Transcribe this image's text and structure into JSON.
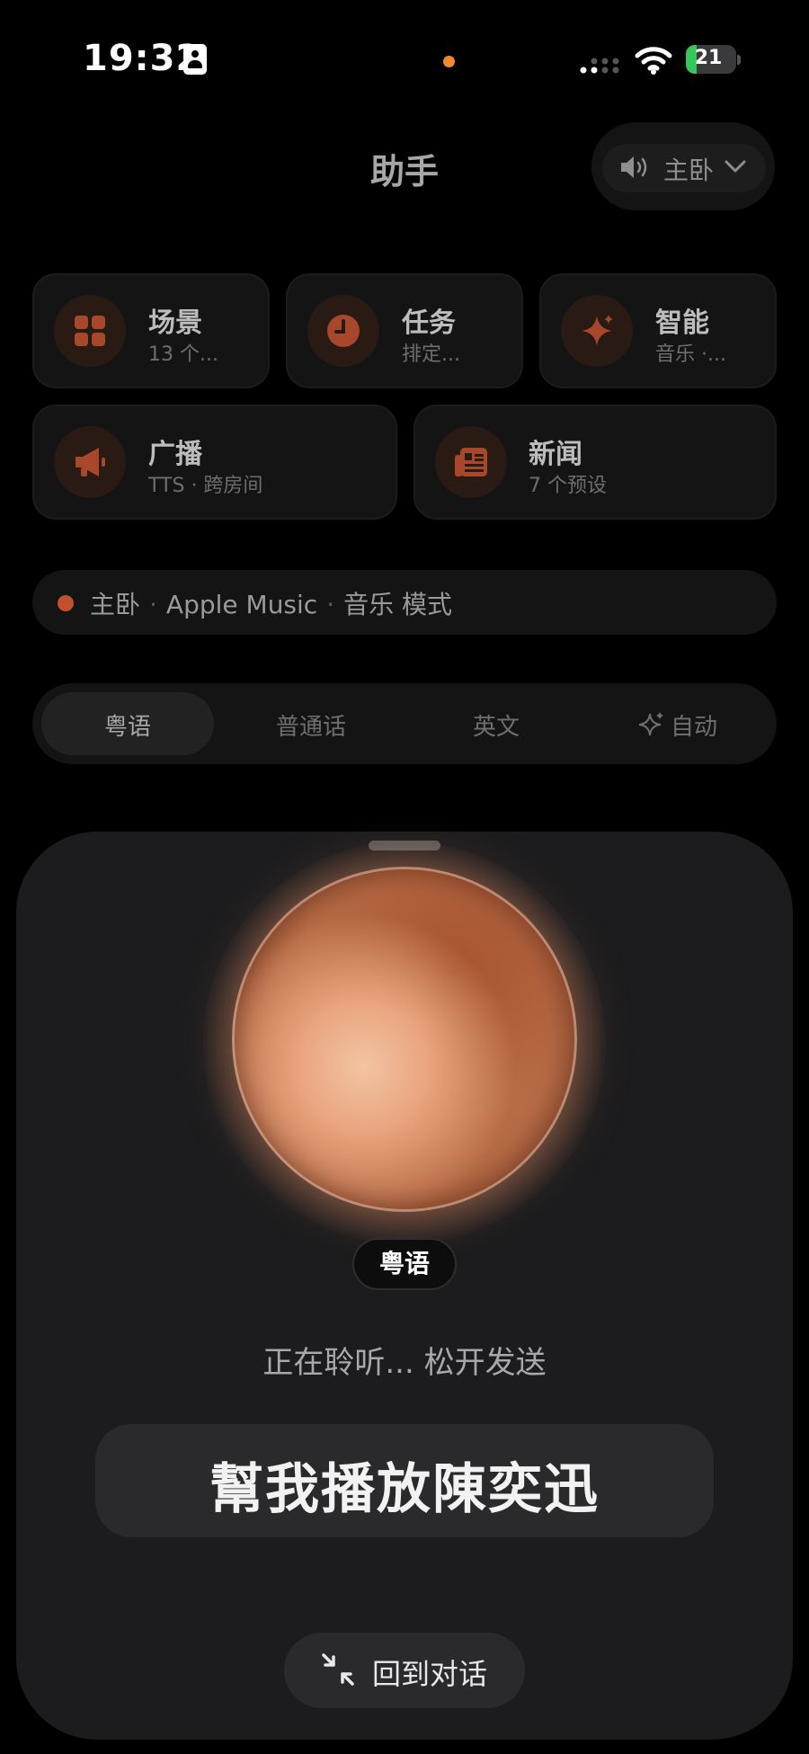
{
  "status_bar": {
    "time": "19:32",
    "battery": "21"
  },
  "header": {
    "title": "助手",
    "room_selector": {
      "label": "主卧",
      "speaker_icon": "speaker-icon",
      "chevron_icon": "chevron-down-icon"
    }
  },
  "quick_actions": [
    {
      "title": "场景",
      "subtitle": "13 个...",
      "icon": "grid-icon"
    },
    {
      "title": "任务",
      "subtitle": "排定...",
      "icon": "clock-icon"
    },
    {
      "title": "智能",
      "subtitle": "音乐 ·...",
      "icon": "sparkle-icon"
    },
    {
      "title": "广播",
      "subtitle": "TTS · 跨房间",
      "icon": "megaphone-icon"
    },
    {
      "title": "新闻",
      "subtitle": "7 个预设",
      "icon": "newspaper-icon"
    }
  ],
  "now_playing": {
    "room": "主卧",
    "source": "Apple Music",
    "mode": "音乐 模式",
    "separator": "·"
  },
  "language_tabs": {
    "items": [
      "粤语",
      "普通话",
      "英文",
      "自动"
    ],
    "selected": "粤语"
  },
  "voice_sheet": {
    "language_chip": "粤语",
    "status": "正在聆听... 松开发送",
    "transcript": "幫我播放陳奕迅",
    "back_button": "回到对话"
  },
  "colors": {
    "accent": "#c2502e",
    "background": "#000000",
    "sheet": "#1c1c1e"
  }
}
